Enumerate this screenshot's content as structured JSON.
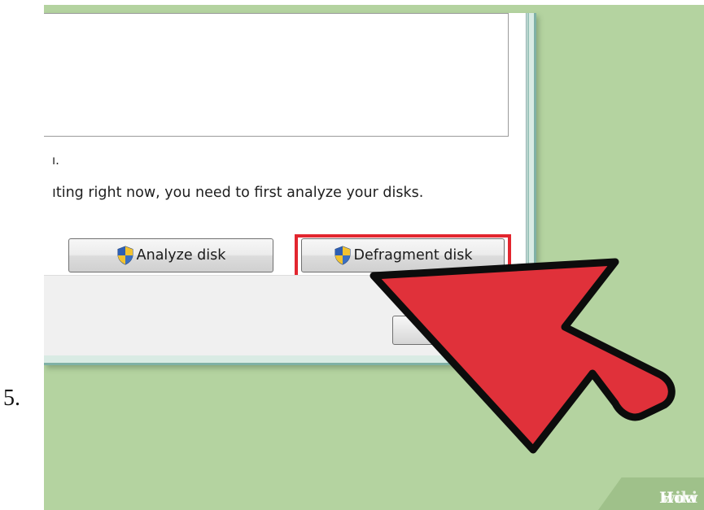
{
  "step": {
    "number": "5."
  },
  "dialog": {
    "status_line_1": "ı.",
    "status_line_2": "ıting right now, you need to first analyze your disks.",
    "analyze_button": "Analyze disk",
    "defragment_button": "Defragment disk"
  },
  "icons": {
    "analyze": "uac-shield-icon",
    "defragment": "uac-shield-icon",
    "pointer": "red-arrow-icon"
  },
  "colors": {
    "background": "#b4d3a0",
    "highlight": "#e2262f",
    "arrow": "#e0313a"
  },
  "watermark": {
    "brand_wiki": "wiki",
    "brand_how": "How"
  }
}
